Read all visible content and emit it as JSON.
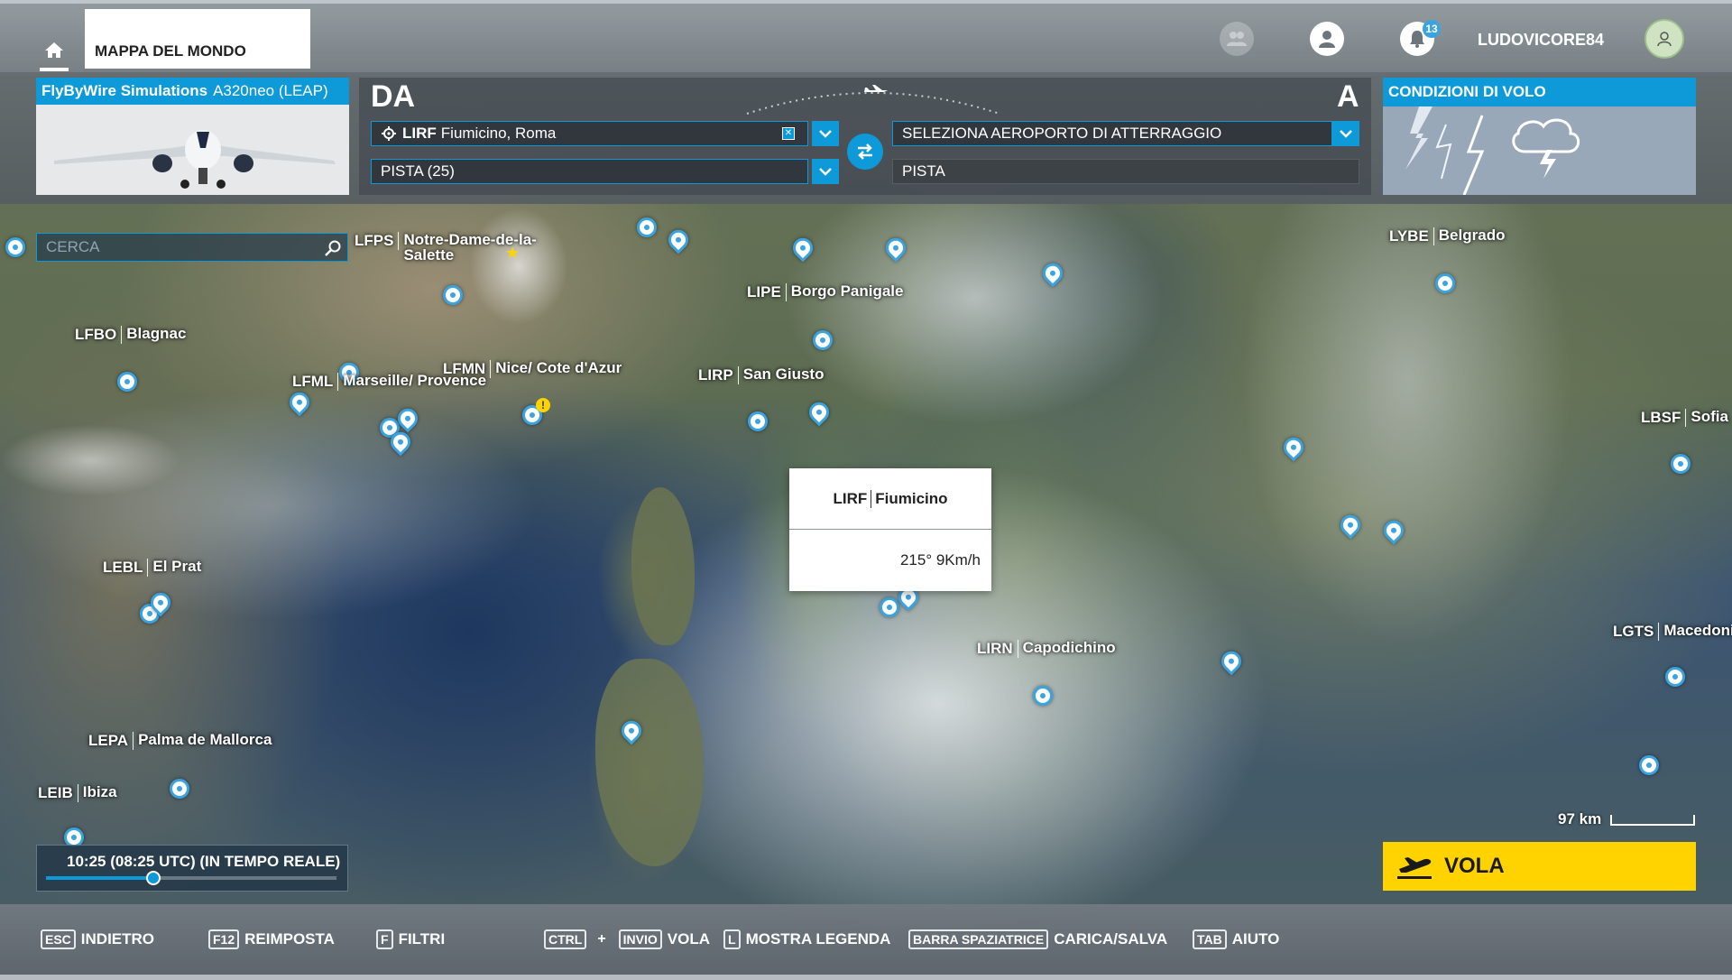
{
  "topbar": {
    "tab_label": "MAPPA DEL MONDO",
    "username": "LUDOVICORE84",
    "notification_count": "13",
    "icons": [
      "home-icon",
      "friends-icon",
      "profile-icon",
      "bell-icon",
      "avatar-icon"
    ]
  },
  "aircraft": {
    "brand": "FlyByWire Simulations",
    "model": "A320neo (LEAP)"
  },
  "route": {
    "from_label": "DA",
    "to_label": "A",
    "departure_code": "LIRF",
    "departure_name": "Fiumicino, Roma",
    "departure_runway": "PISTA (25)",
    "arrival_placeholder": "SELEZIONA AEROPORTO DI ATTERRAGGIO",
    "arrival_runway": "PISTA"
  },
  "weather": {
    "title": "CONDIZIONI DI VOLO"
  },
  "search": {
    "placeholder": "CERCA"
  },
  "map": {
    "airports": [
      {
        "code": "LFPS",
        "name": "Notre-Dame-de-la-Salette"
      },
      {
        "code": "LIPE",
        "name": "Borgo Panigale"
      },
      {
        "code": "LYBE",
        "name": "Belgrado"
      },
      {
        "code": "LFBO",
        "name": "Blagnac"
      },
      {
        "code": "LFMN",
        "name": "Nice/ Cote d'Azur"
      },
      {
        "code": "LIRP",
        "name": "San Giusto"
      },
      {
        "code": "LFML",
        "name": "Marseille/ Provence"
      },
      {
        "code": "LBSF",
        "name": "Sofia"
      },
      {
        "code": "LEBL",
        "name": "El Prat"
      },
      {
        "code": "LIRN",
        "name": "Capodichino"
      },
      {
        "code": "LGTS",
        "name": "Macedoni"
      },
      {
        "code": "LEPA",
        "name": "Palma de Mallorca"
      },
      {
        "code": "LEIB",
        "name": "Ibiza"
      }
    ],
    "popup": {
      "code": "LIRF",
      "name": "Fiumicino",
      "wind": "215° 9Km/h"
    },
    "scale_label": "97 km"
  },
  "time": {
    "label": "10:25 (08:25 UTC) (IN TEMPO REALE)",
    "progress": 0.37
  },
  "fly_button": {
    "label": "VOLA"
  },
  "bottom_hints": [
    {
      "key": "ESC",
      "label": "INDIETRO"
    },
    {
      "key": "F12",
      "label": "REIMPOSTA"
    },
    {
      "key": "F",
      "label": "FILTRI"
    },
    {
      "key": "CTRL",
      "key2": "INVIO",
      "plus": "+",
      "label": "VOLA"
    },
    {
      "key": "L",
      "label": "MOSTRA LEGENDA"
    },
    {
      "key": "BARRA SPAZIATRICE",
      "label": "CARICA/SALVA"
    },
    {
      "key": "TAB",
      "label": "AIUTO"
    }
  ],
  "colors": {
    "accent": "#0e9ad8",
    "fly_button": "#ffd300",
    "pin": "#3ba4e0"
  }
}
